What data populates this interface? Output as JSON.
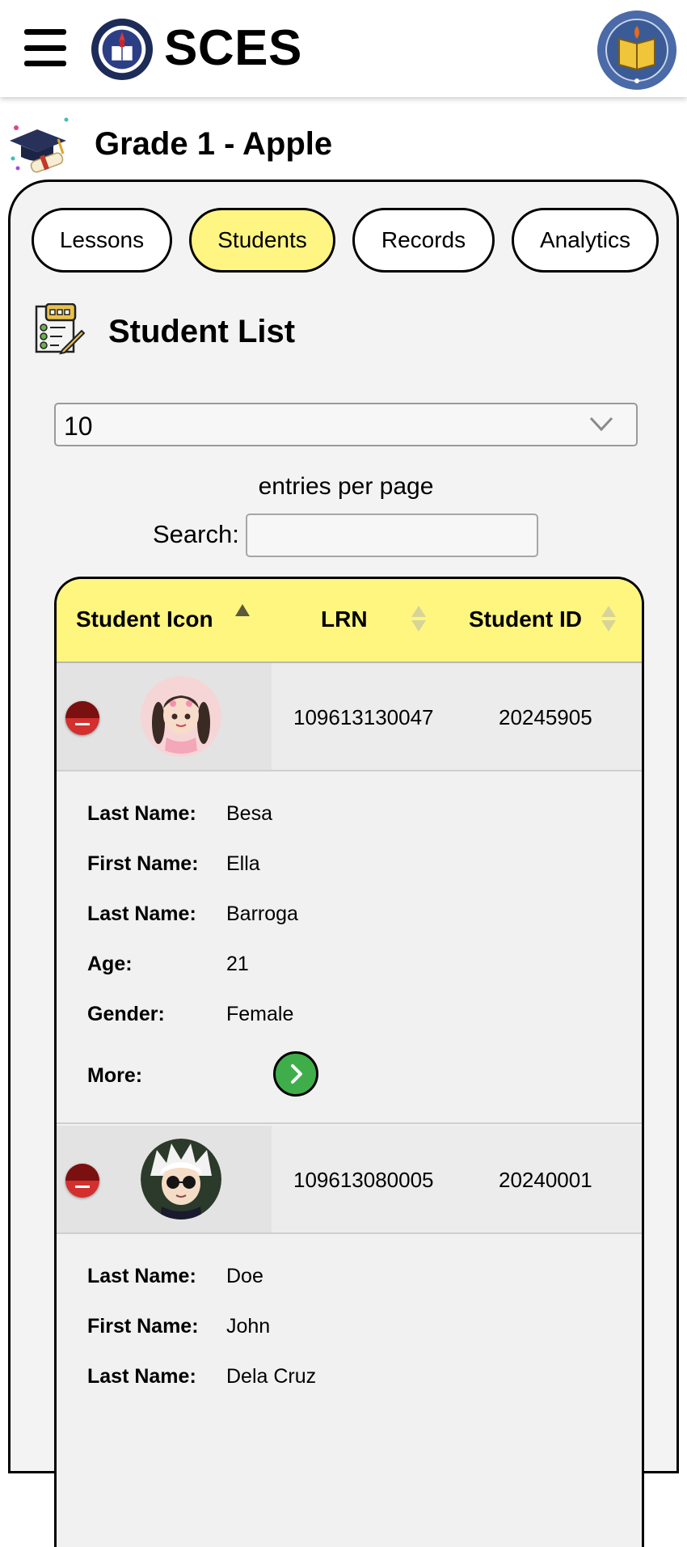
{
  "header": {
    "brand": "SCES",
    "left_logo_icon": "school-seal-icon",
    "right_logo_icon": "pamunuan-seal-icon",
    "menu_icon": "hamburger-menu-icon"
  },
  "class_title": "Grade 1 - Apple",
  "tabs": [
    {
      "label": "Lessons",
      "active": false
    },
    {
      "label": "Students",
      "active": true
    },
    {
      "label": "Records",
      "active": false
    },
    {
      "label": "Analytics",
      "active": false
    }
  ],
  "section_title": "Student List",
  "table_controls": {
    "entries_value": "10",
    "entries_label": "entries per page",
    "search_label": "Search:",
    "search_value": ""
  },
  "table": {
    "columns": [
      "Student Icon",
      "LRN",
      "Student ID"
    ],
    "rows": [
      {
        "lrn": "109613130047",
        "student_id": "20245905",
        "avatar": "girl-avatar",
        "details": [
          {
            "label": "Last Name:",
            "value": "Besa"
          },
          {
            "label": "First Name:",
            "value": "Ella"
          },
          {
            "label": "Last Name:",
            "value": "Barroga"
          },
          {
            "label": "Age:",
            "value": "21"
          },
          {
            "label": "Gender:",
            "value": "Female"
          },
          {
            "label": "More:",
            "value": ""
          }
        ]
      },
      {
        "lrn": "109613080005",
        "student_id": "20240001",
        "avatar": "boy-avatar",
        "details": [
          {
            "label": "Last Name:",
            "value": "Doe"
          },
          {
            "label": "First Name:",
            "value": "John"
          },
          {
            "label": "Last Name:",
            "value": "Dela Cruz"
          }
        ]
      }
    ]
  },
  "colors": {
    "active_tab": "#fff582",
    "table_header": "#fff67f",
    "collapse_button": "#d32f2f",
    "more_button": "#3fae4a"
  }
}
